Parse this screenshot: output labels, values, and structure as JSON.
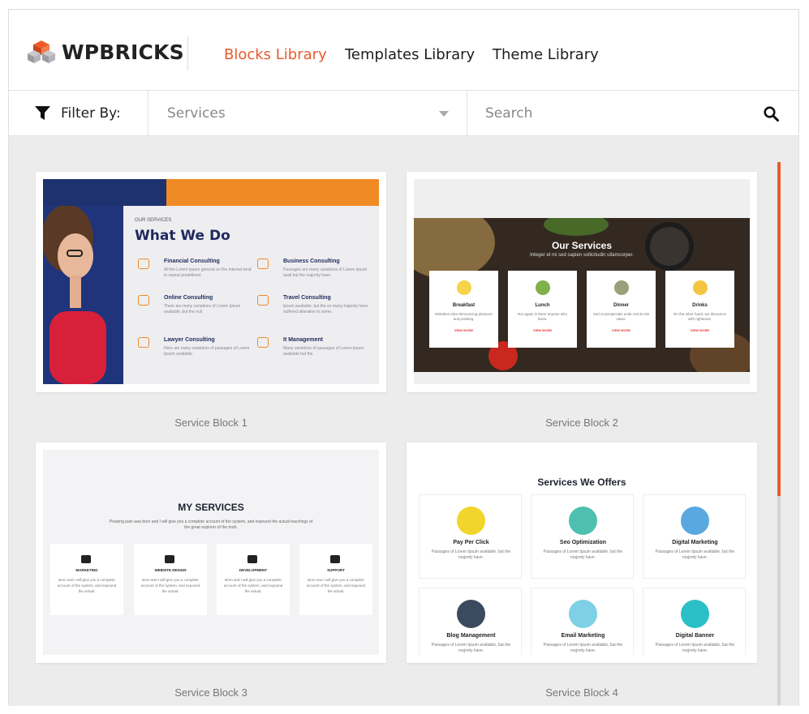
{
  "brand": {
    "name": "WPBRICKS"
  },
  "nav": {
    "tabs": [
      {
        "label": "Blocks Library",
        "active": true
      },
      {
        "label": "Templates Library",
        "active": false
      },
      {
        "label": "Theme Library",
        "active": false
      }
    ]
  },
  "filter": {
    "label": "Filter By:",
    "selected": "Services",
    "search_placeholder": "Search"
  },
  "colors": {
    "accent": "#e85a2c",
    "text": "#222222"
  },
  "blocks": [
    {
      "caption": "Service Block 1",
      "preview": {
        "eyebrow": "OUR SERVICES",
        "heading": "What We Do",
        "items": [
          {
            "name": "Financial Consulting",
            "desc": "All the Lorem Ipsum generat on the Internet tend to repeat predefined."
          },
          {
            "name": "Business Consulting",
            "desc": "Passages are many variations of Lorem Ipsum avail but the majority have."
          },
          {
            "name": "Online Consulting",
            "desc": "There are many variations of Lorem Ipsum available, but the null"
          },
          {
            "name": "Travel Consulting",
            "desc": "Ipsum available, but the ex many majority have suffered alteration in some."
          },
          {
            "name": "Lawyer Consulting",
            "desc": "Here are many variations of passages of Lorem Ipsum available."
          },
          {
            "name": "It Management",
            "desc": "Many variations of passages of Lorem Ipsum available but the."
          }
        ]
      }
    },
    {
      "caption": "Service Block 2",
      "preview": {
        "heading": "Our Services",
        "sub": "Integer et mi sed sapien sollicitudin ullamcorper.",
        "items": [
          {
            "name": "Breakfast",
            "desc": "Mistaken idea denouncing pleasure and praising.",
            "link": "VIEW MORE"
          },
          {
            "name": "Lunch",
            "desc": "Nor again is there anyone who loves.",
            "link": "VIEW MORE"
          },
          {
            "name": "Dinner",
            "desc": "Sed ut perspiciatis unde omnis iste natus.",
            "link": "VIEW MORE"
          },
          {
            "name": "Drinks",
            "desc": "On the other hand, we denounce with righteous.",
            "link": "VIEW MORE"
          }
        ]
      }
    },
    {
      "caption": "Service Block 3",
      "preview": {
        "heading": "MY SERVICES",
        "sub": "Praising pain was born and I will give you a complete account of the system, and expound the actual teachings of the great explorer of the truth.",
        "items": [
          {
            "name": "MARKETING",
            "desc": "Born and I will give you a complete account of the system, and expound the actual."
          },
          {
            "name": "WEBSITE DESIGN",
            "desc": "Born and I will give you a complete account of the system, and expound the actual."
          },
          {
            "name": "DEVELOPMENT",
            "desc": "Born and I will give you a complete account of the system, and expound the actual."
          },
          {
            "name": "SUPPORT",
            "desc": "Born and I will give you a complete account of the system, and expound the actual."
          }
        ]
      }
    },
    {
      "caption": "Service Block 4",
      "preview": {
        "heading": "Services We Offers",
        "items": [
          {
            "name": "Pay Per Click",
            "desc": "Passages of Lorem Ipsum available, but the majority have."
          },
          {
            "name": "Seo Optimization",
            "desc": "Passages of Lorem Ipsum available, but the majority have."
          },
          {
            "name": "Digital Marketing",
            "desc": "Passages of Lorem Ipsum available, but the majority have."
          },
          {
            "name": "Blog Management",
            "desc": "Passages of Lorem Ipsum available, but the majority have."
          },
          {
            "name": "Email Marketing",
            "desc": "Passages of Lorem Ipsum available, but the majority have."
          },
          {
            "name": "Digital Banner",
            "desc": "Passages of Lorem Ipsum available, but the majority have."
          }
        ]
      }
    }
  ]
}
